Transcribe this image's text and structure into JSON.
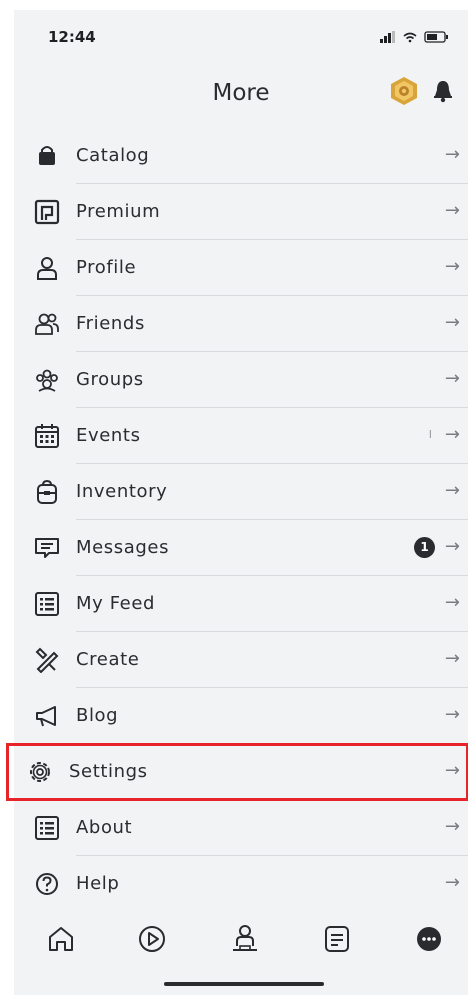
{
  "status_bar": {
    "time": "12:44"
  },
  "header": {
    "title": "More"
  },
  "menu": [
    {
      "label": "Catalog",
      "icon": "shopping-bag-icon"
    },
    {
      "label": "Premium",
      "icon": "premium-icon"
    },
    {
      "label": "Profile",
      "icon": "user-icon"
    },
    {
      "label": "Friends",
      "icon": "friends-icon"
    },
    {
      "label": "Groups",
      "icon": "groups-icon"
    },
    {
      "label": "Events",
      "icon": "calendar-icon"
    },
    {
      "label": "Inventory",
      "icon": "backpack-icon"
    },
    {
      "label": "Messages",
      "icon": "message-icon",
      "badge": "1"
    },
    {
      "label": "My Feed",
      "icon": "feed-icon"
    },
    {
      "label": "Create",
      "icon": "create-tools-icon"
    },
    {
      "label": "Blog",
      "icon": "megaphone-icon"
    },
    {
      "label": "Settings",
      "icon": "gear-icon"
    },
    {
      "label": "About",
      "icon": "about-list-icon"
    },
    {
      "label": "Help",
      "icon": "help-icon"
    }
  ],
  "arrow_glyph": "→",
  "events_indicator": "I",
  "tabs": [
    "home-icon",
    "play-icon",
    "avatar-icon",
    "chat-icon",
    "more-icon"
  ],
  "colors": {
    "highlight": "#e8242b",
    "robux_gold": "#d9a53a",
    "text": "#2b2c30"
  }
}
